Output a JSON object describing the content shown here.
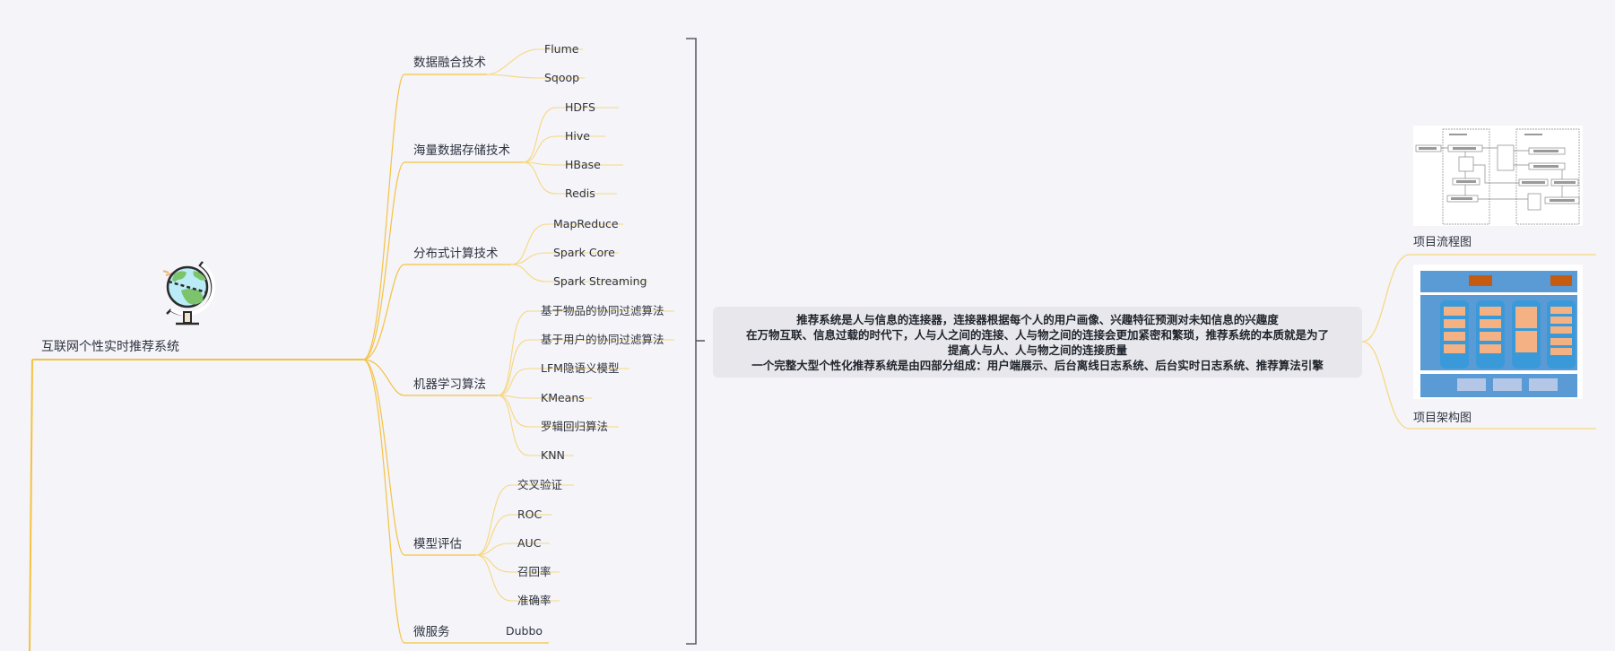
{
  "root": {
    "label": "互联网个性实时推荐系统",
    "icon": "globe-icon"
  },
  "branches": [
    {
      "label": "数据融合技术",
      "children": [
        "Flume",
        "Sqoop"
      ]
    },
    {
      "label": "海量数据存储技术",
      "children": [
        "HDFS",
        "Hive",
        "HBase",
        "Redis"
      ]
    },
    {
      "label": "分布式计算技术",
      "children": [
        "MapReduce",
        "Spark Core",
        "Spark Streaming"
      ]
    },
    {
      "label": "机器学习算法",
      "children": [
        "基于物品的协同过滤算法",
        "基于用户的协同过滤算法",
        "LFM隐语义模型",
        "KMeans",
        "罗辑回归算法",
        "KNN"
      ]
    },
    {
      "label": "模型评估",
      "children": [
        "交叉验证",
        "ROC",
        "AUC",
        "召回率",
        "准确率"
      ]
    },
    {
      "label": "微服务",
      "children": [
        "Dubbo"
      ]
    }
  ],
  "summary": {
    "lines": [
      "推荐系统是人与信息的连接器，连接器根据每个人的用户画像、兴趣特征预测对未知信息的兴趣度",
      "在万物互联、信息过载的时代下，人与人之间的连接、人与物之间的连接会更加紧密和繁琐，推荐系统的本质就是为了",
      "提高人与人、人与物之间的连接质量",
      "一个完整大型个性化推荐系统是由四部分组成：用户端展示、后台离线日志系统、后台实时日志系统、推荐算法引擎"
    ]
  },
  "attachments": [
    {
      "label": "项目流程图",
      "image": "flowchart-image"
    },
    {
      "label": "项目架构图",
      "image": "architecture-image"
    }
  ],
  "colors": {
    "background": "#f4f4f9",
    "branch_line": "#f5c242",
    "leaf_line": "#f7d77e",
    "bracket": "#5b5d66",
    "summary_bg": "#e8e8ec"
  }
}
